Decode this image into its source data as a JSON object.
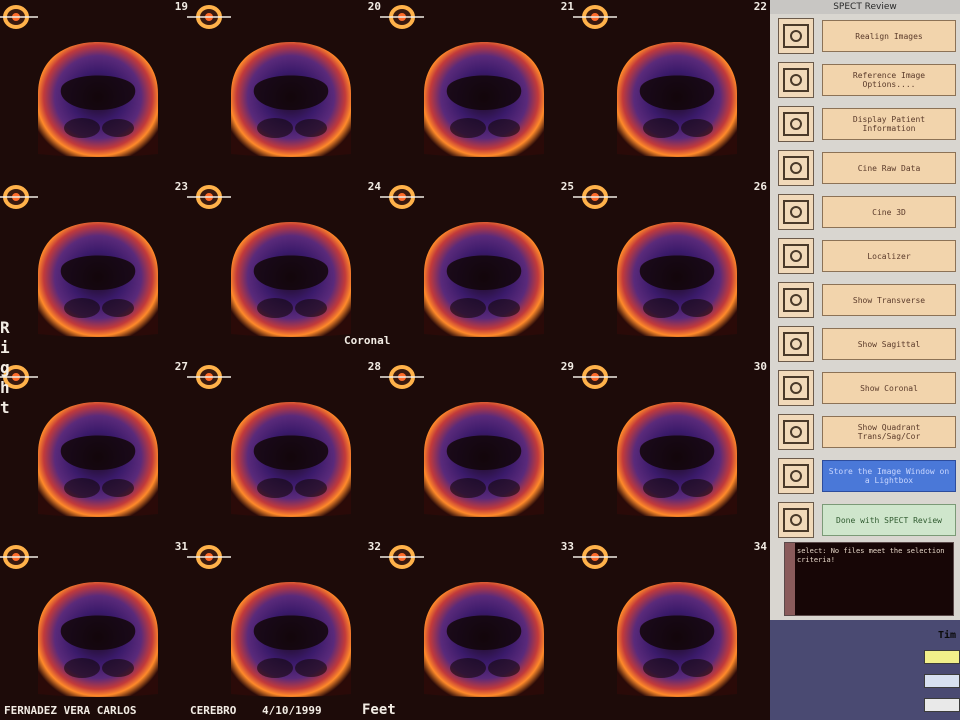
{
  "orientation": {
    "right_label": "Right",
    "view_label": "Coronal",
    "bottom_label": "Feet"
  },
  "patient": {
    "name": "FERNADEZ VERA CARLOS",
    "study": "CEREBRO",
    "date": "4/10/1999"
  },
  "slices": [
    19,
    20,
    21,
    22,
    23,
    24,
    25,
    26,
    27,
    28,
    29,
    30,
    31,
    32,
    33,
    34
  ],
  "panel": {
    "title": "SPECT Review",
    "tools": [
      {
        "label": "Realign Images",
        "icon": "realign-icon",
        "style": "normal"
      },
      {
        "label": "Reference Image Options....",
        "icon": "reference-image-icon",
        "style": "normal"
      },
      {
        "label": "Display Patient Information",
        "icon": "patient-info-icon",
        "style": "normal"
      },
      {
        "label": "Cine Raw Data",
        "icon": "cine-raw-icon",
        "style": "normal"
      },
      {
        "label": "Cine 3D",
        "icon": "cine-3d-icon",
        "style": "normal"
      },
      {
        "label": "Localizer",
        "icon": "localizer-icon",
        "style": "normal"
      },
      {
        "label": "Show Transverse",
        "icon": "transverse-head-icon",
        "style": "normal"
      },
      {
        "label": "Show Sagittal",
        "icon": "sagittal-head-icon",
        "style": "normal"
      },
      {
        "label": "Show Coronal",
        "icon": "coronal-head-icon",
        "style": "normal"
      },
      {
        "label": "Show Quadrant Trans/Sag/Cor",
        "icon": "quadrant-icon",
        "style": "normal"
      },
      {
        "label": "Store the Image Window on a Lightbox",
        "icon": "store-icon",
        "style": "blue"
      },
      {
        "label": "Done with SPECT Review",
        "icon": "done-icon",
        "style": "green"
      }
    ],
    "console_text": "select: No files meet the selection criteria!",
    "bottom_label": "Tim"
  },
  "colors": {
    "background": "#1d0b09",
    "hot_edge": "#ff9a3a",
    "cold_core": "#3a1a6a",
    "panel_bg": "#d9d6d0"
  }
}
